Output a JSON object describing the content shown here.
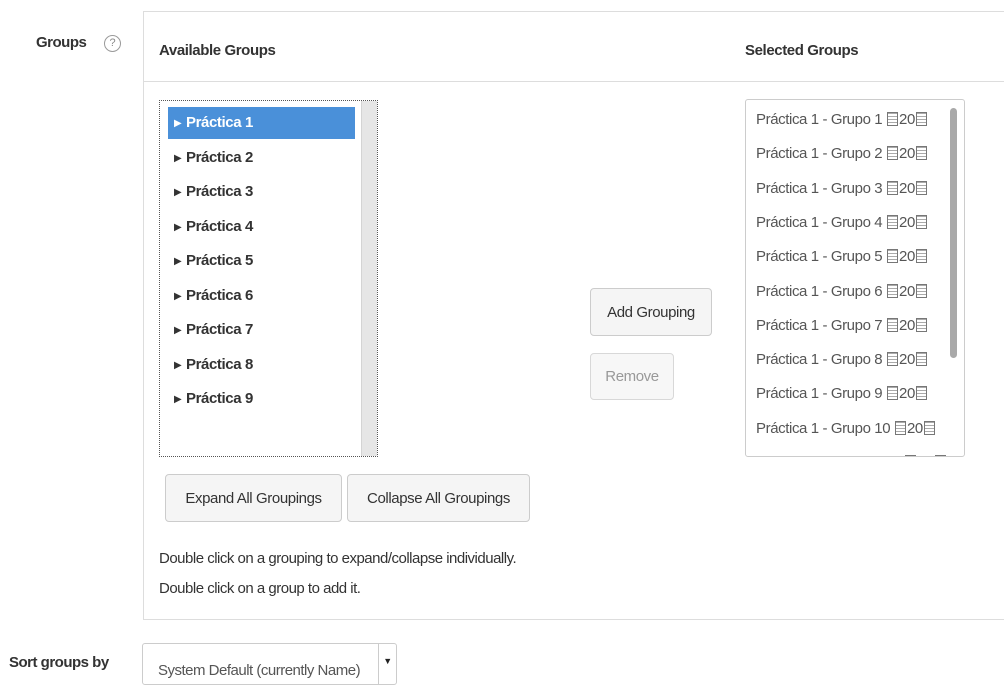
{
  "groups_field": {
    "label": "Groups",
    "help_glyph": "?"
  },
  "available": {
    "header": "Available Groups",
    "arrow": "▶",
    "items": [
      {
        "label": "Práctica 1",
        "selected": true
      },
      {
        "label": "Práctica 2",
        "selected": false
      },
      {
        "label": "Práctica 3",
        "selected": false
      },
      {
        "label": "Práctica 4",
        "selected": false
      },
      {
        "label": "Práctica 5",
        "selected": false
      },
      {
        "label": "Práctica 6",
        "selected": false
      },
      {
        "label": "Práctica 7",
        "selected": false
      },
      {
        "label": "Práctica 8",
        "selected": false
      },
      {
        "label": "Práctica 9",
        "selected": false
      }
    ]
  },
  "actions": {
    "add_label": "Add Grouping",
    "remove_label": "Remove"
  },
  "selected": {
    "header": "Selected Groups",
    "digits": "20",
    "items": [
      "Práctica 1 - Grupo 1",
      "Práctica 1 - Grupo 2",
      "Práctica 1 - Grupo 3",
      "Práctica 1 - Grupo 4",
      "Práctica 1 - Grupo 5",
      "Práctica 1 - Grupo 6",
      "Práctica 1 - Grupo 7",
      "Práctica 1 - Grupo 8",
      "Práctica 1 - Grupo 9",
      "Práctica 1 - Grupo 10"
    ]
  },
  "tree_buttons": {
    "expand_label": "Expand All Groupings",
    "collapse_label": "Collapse All Groupings"
  },
  "hints": {
    "line1": "Double click on a grouping to expand/collapse individually.",
    "line2": "Double click on a group to add it."
  },
  "sort": {
    "label": "Sort groups by",
    "value": "System Default (currently Name)",
    "arrow": "▼"
  },
  "colors": {
    "selected_bg": "#4a90d9",
    "border": "#dddddd"
  }
}
